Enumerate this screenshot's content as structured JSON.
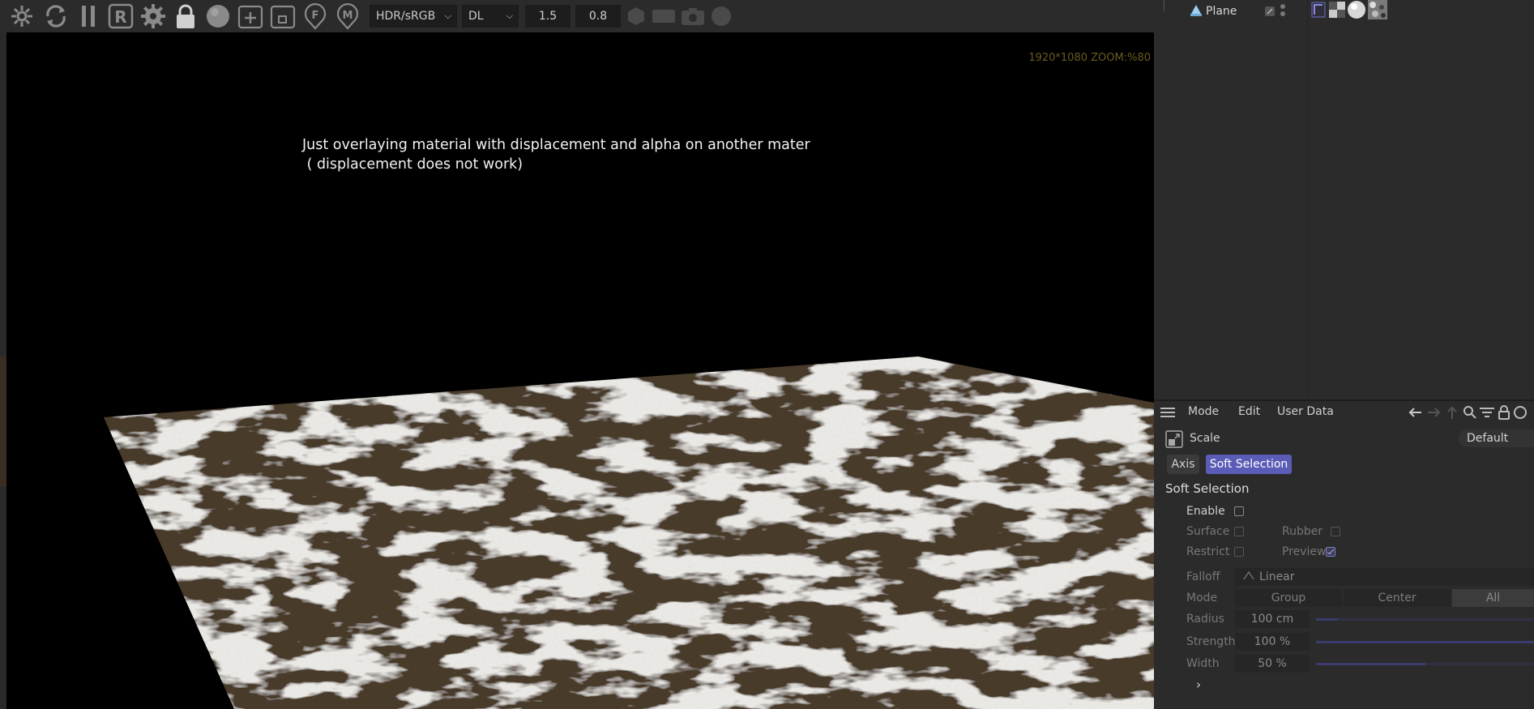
{
  "toolbar": {
    "icons": [
      "settings-gear-refresh-icon",
      "refresh-icon",
      "pause-icon",
      "region-render-icon",
      "settings-icon",
      "lock-icon",
      "sphere-icon",
      "add-icon",
      "box-icon",
      "f-marker-icon",
      "m-marker-icon"
    ],
    "color_space": "HDR/sRGB",
    "render_mode": "DL",
    "value1": "1.5",
    "value2": "0.8",
    "right_icons": [
      "hex-icon",
      "rect-icon",
      "camera-icon",
      "circle-icon"
    ]
  },
  "render": {
    "resolution_label": "1920*1080 ZOOM:%80",
    "caption_line1": "Just overlaying material with displacement and alpha on another mater",
    "caption_line2": " ( displacement does not work)"
  },
  "object_manager": {
    "object_name": "Plane"
  },
  "attributes": {
    "menu": [
      "Mode",
      "Edit",
      "User Data"
    ],
    "tool_name": "Scale",
    "preset": "Default",
    "tabs": [
      {
        "label": "Axis",
        "active": false
      },
      {
        "label": "Soft Selection",
        "active": true
      }
    ],
    "section_title": "Soft Selection",
    "enable_label": "Enable",
    "surface_label": "Surface",
    "rubber_label": "Rubber",
    "restrict_label": "Restrict",
    "preview_label": "Preview",
    "falloff_label": "Falloff",
    "falloff_value": "Linear",
    "mode_label": "Mode",
    "mode_options": [
      "Group",
      "Center",
      "All"
    ],
    "mode_selected": "All",
    "radius_label": "Radius",
    "radius_value": "100 cm",
    "radius_fraction": 0.1,
    "strength_label": "Strength",
    "strength_value": "100 %",
    "strength_fraction": 1.0,
    "width_label": "Width",
    "width_value": "50 %",
    "width_fraction": 0.5,
    "checkboxes": {
      "enable": false,
      "surface": false,
      "rubber": false,
      "restrict": false,
      "preview": true
    }
  },
  "colors": {
    "accent": "#5b5bb8",
    "panel_bg": "#2b2b2b",
    "viewport_bg": "#000000"
  }
}
